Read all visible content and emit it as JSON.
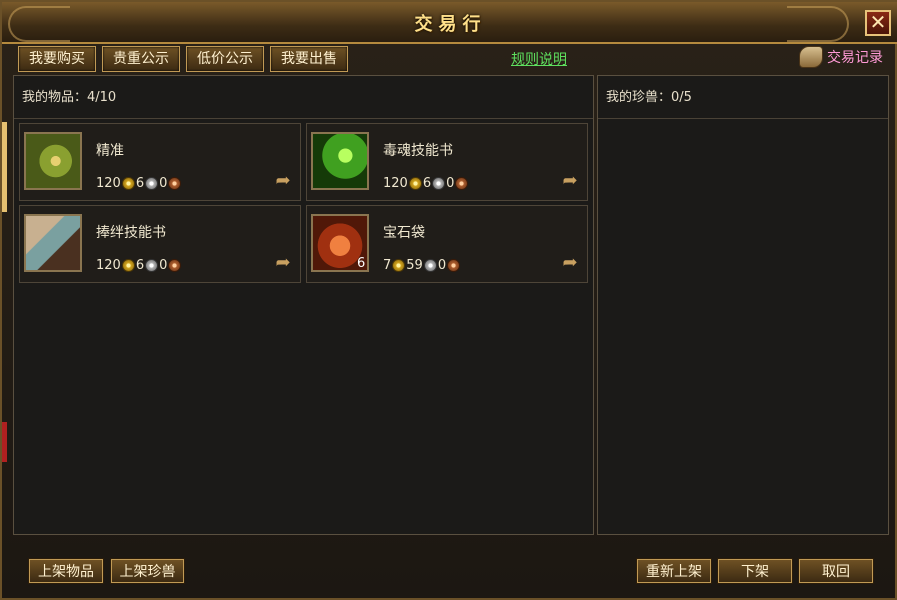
{
  "window": {
    "title": "交易行"
  },
  "tabs": [
    {
      "label": "我要购买"
    },
    {
      "label": "贵重公示"
    },
    {
      "label": "低价公示"
    },
    {
      "label": "我要出售"
    }
  ],
  "rules_link": "规则说明",
  "trade_record": "交易记录",
  "left_panel": {
    "header": "我的物品：4/10"
  },
  "right_panel": {
    "header": "我的珍兽：0/5"
  },
  "items": [
    {
      "name": "精准",
      "price": {
        "gold": "120",
        "silver": "6",
        "copper": "0"
      },
      "icon": "compass-icon",
      "quantity": ""
    },
    {
      "name": "毒魂技能书",
      "price": {
        "gold": "120",
        "silver": "6",
        "copper": "0"
      },
      "icon": "poison-skillbook-icon",
      "quantity": ""
    },
    {
      "name": "捧绊技能书",
      "price": {
        "gold": "120",
        "silver": "6",
        "copper": "0"
      },
      "icon": "bind-skillbook-icon",
      "quantity": ""
    },
    {
      "name": "宝石袋",
      "price": {
        "gold": "7",
        "silver": "59",
        "copper": "0"
      },
      "icon": "gem-bag-icon",
      "quantity": "6"
    }
  ],
  "buttons": {
    "list_item": "上架物品",
    "list_pet": "上架珍兽",
    "relist": "重新上架",
    "delist": "下架",
    "cancel": "取回"
  },
  "colors": {
    "accent_gold": "#ffe08a",
    "link_green": "#5ee05e",
    "record_pink": "#ff9ad6"
  }
}
